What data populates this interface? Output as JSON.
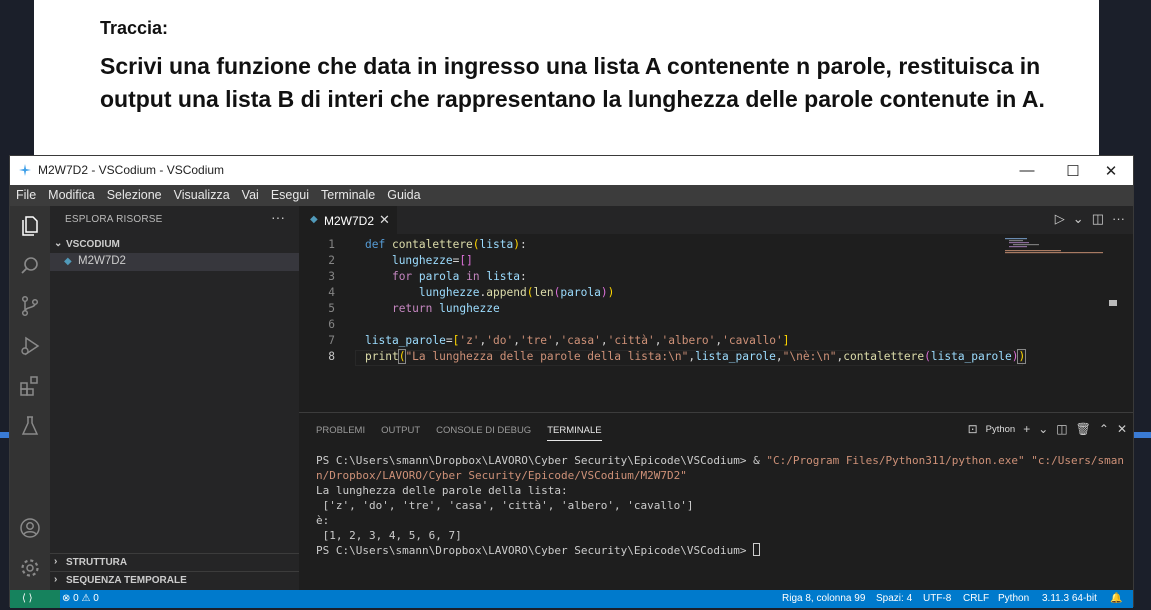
{
  "document": {
    "task_label": "Traccia:",
    "task_text": "Scrivi una funzione che data in ingresso una lista A contenente n parole, restituisca in output una lista B di interi che rappresentano la lunghezza delle parole contenute in A."
  },
  "window": {
    "title": "M2W7D2 - VSCodium - VSCodium",
    "minimize": "—",
    "maximize": "☐",
    "close": "✕"
  },
  "menu": [
    "File",
    "Modifica",
    "Selezione",
    "Visualizza",
    "Vai",
    "Esegui",
    "Terminale",
    "Guida"
  ],
  "sidebar": {
    "header": "ESPLORA RISORSE",
    "more": "···",
    "folder": "VSCODIUM",
    "file": "M2W7D2",
    "outline": "STRUTTURA",
    "timeline": "SEQUENZA TEMPORALE"
  },
  "editor": {
    "tab_label": "M2W7D2",
    "tab_close": "✕",
    "line_numbers": [
      "1",
      "2",
      "3",
      "4",
      "5",
      "6",
      "7",
      "8"
    ]
  },
  "panel": {
    "tabs": [
      "PROBLEMI",
      "OUTPUT",
      "CONSOLE DI DEBUG",
      "TERMINALE"
    ],
    "active_tab": "TERMINALE",
    "shell": "Python",
    "terminal": {
      "prompt1": "PS C:\\Users\\smann\\Dropbox\\LAVORO\\Cyber Security\\Epicode\\VSCodium> & ",
      "cmd1": "\"C:/Program Files/Python311/python.exe\" \"c:/Users/smann/Dropbox/LAVORO/Cyber Security/Epicode/VSCodium/M2W7D2\"",
      "out1": "La lunghezza delle parole della lista:",
      "out2": " ['z', 'do', 'tre', 'casa', 'città', 'albero', 'cavallo']",
      "out3": "è:",
      "out4": " [1, 2, 3, 4, 5, 6, 7]",
      "prompt2": "PS C:\\Users\\smann\\Dropbox\\LAVORO\\Cyber Security\\Epicode\\VSCodium> "
    }
  },
  "status": {
    "remote": "⟨ ⟩",
    "problems": "⊗ 0 ⚠ 0",
    "position": "Riga 8, colonna 99",
    "spaces": "Spazi: 4",
    "encoding": "UTF-8",
    "eol": "CRLF",
    "language": "Python",
    "interpreter": "3.11.3 64-bit"
  },
  "colors": {
    "statusbar": "#007acc",
    "activity_bar": "#333333",
    "sidebar": "#252526",
    "editor": "#1e1e1e"
  }
}
